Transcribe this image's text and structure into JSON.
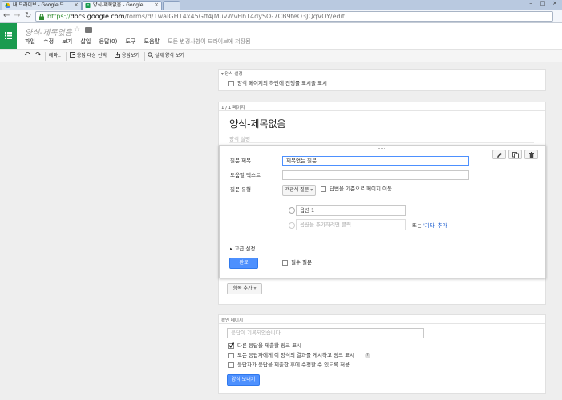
{
  "browser": {
    "tabs": [
      {
        "title": "내 드라이브 - Google 드"
      },
      {
        "title": "양식-제목없음 - Google"
      }
    ],
    "url_scheme": "https://",
    "url_host": "docs.google.com",
    "url_path": "/forms/d/1waIGH14x45Gff4jMuvWvHhT4dySO-7CB9teO3JQqVOY/edit"
  },
  "app": {
    "doc_title": "양식-제목없음",
    "menu": [
      "파일",
      "수정",
      "보기",
      "삽입",
      "응답(0)",
      "도구",
      "도움말"
    ],
    "save_status": "모든 변경사항이 드라이브에 저장됨",
    "toolbar": {
      "theme": "테마..",
      "response_destination": "응답 대상 선택",
      "view_responses": "응답보기",
      "view_live_form": "실제 양식 보기"
    }
  },
  "form_settings": {
    "header": "양식 설정",
    "show_progress": "양식 페이지의 하단에 진행률 표시줄 표시"
  },
  "page": {
    "page_label": "1 / 1 페이지",
    "form_title": "양식-제목없음",
    "form_description_placeholder": "양식 설명"
  },
  "question": {
    "title_label": "질문 제목",
    "title_value": "제목없는 질문",
    "help_label": "도움말 텍스트",
    "type_label": "질문 유형",
    "type_value": "객관식 질문",
    "page_by_answer": "답변을 기준으로 페이지 이동",
    "option1": "옵션 1",
    "add_option_placeholder": "옵션을 추가하려면 클릭",
    "or_text": "또는",
    "add_other": "'기타' 추가",
    "advanced": "고급 설정",
    "done": "완료",
    "required": "필수 질문"
  },
  "add_item": "항목 추가",
  "confirmation": {
    "header": "확인 페이지",
    "message_placeholder": "응답이 기록되었습니다.",
    "show_link_another": "다른 응답을 제출할 링크 표시",
    "show_results_link": "모든 응답자에게 이 양식의 결과를 게시하고 링크 표시",
    "help_mark": "?",
    "allow_edit": "응답자가 응답을 제출한 후에 수정할 수 있도록 허용",
    "send_form": "양식 보내기"
  },
  "colors": {
    "accent_blue": "#4d90fe",
    "app_green": "#1a9b4f",
    "link_blue": "#1155cc"
  }
}
